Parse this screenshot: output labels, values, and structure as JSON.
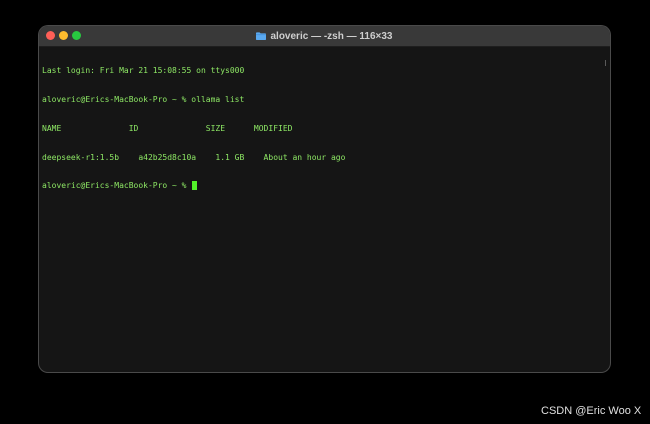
{
  "window": {
    "title": "aloveric — -zsh — 116×33",
    "title_icon": "folder-icon",
    "traffic_lights": {
      "close_color": "#fe5f57",
      "minimize_color": "#febc2e",
      "maximize_color": "#28c840"
    }
  },
  "terminal": {
    "text_color": "#8ee865",
    "background": "#151515",
    "lines": [
      "Last login: Fri Mar 21 15:08:55 on ttys000",
      "aloveric@Erics-MacBook-Pro ~ % ollama list",
      "NAME              ID              SIZE      MODIFIED",
      "deepseek-r1:1.5b    a42b25d8c10a    1.1 GB    About an hour ago",
      "aloveric@Erics-MacBook-Pro ~ % "
    ]
  },
  "watermark": "CSDN @Eric Woo X"
}
